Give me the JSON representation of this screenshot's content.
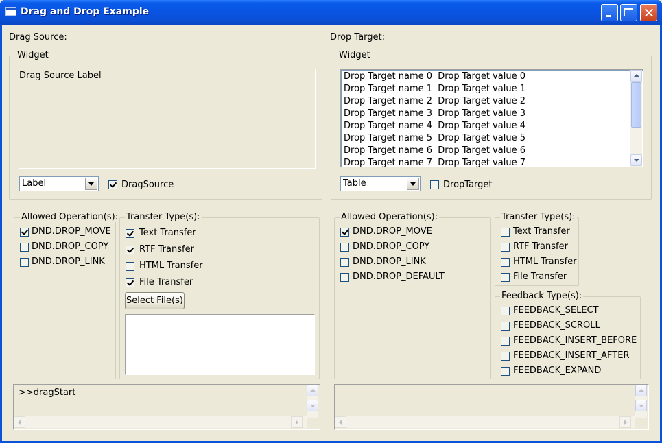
{
  "window": {
    "title": "Drag and Drop Example"
  },
  "source": {
    "heading": "Drag Source:",
    "widget_group": "Widget",
    "widget_label": "Drag Source Label",
    "widget_type": "Label",
    "enable_label": "DragSource",
    "enable_checked": true,
    "ops_title": "Allowed Operation(s):",
    "ops": [
      {
        "label": "DND.DROP_MOVE",
        "checked": true
      },
      {
        "label": "DND.DROP_COPY",
        "checked": false
      },
      {
        "label": "DND.DROP_LINK",
        "checked": false
      }
    ],
    "types_title": "Transfer Type(s):",
    "types": [
      {
        "label": "Text Transfer",
        "checked": true
      },
      {
        "label": "RTF Transfer",
        "checked": true
      },
      {
        "label": "HTML Transfer",
        "checked": false
      },
      {
        "label": "File Transfer",
        "checked": true
      }
    ],
    "select_files_label": "Select File(s)",
    "log_text": ">>dragStart"
  },
  "target": {
    "heading": "Drop Target:",
    "widget_group": "Widget",
    "table_rows": [
      {
        "name": "Drop Target name 0",
        "value": "Drop Target value 0"
      },
      {
        "name": "Drop Target name 1",
        "value": "Drop Target value 1"
      },
      {
        "name": "Drop Target name 2",
        "value": "Drop Target value 2"
      },
      {
        "name": "Drop Target name 3",
        "value": "Drop Target value 3"
      },
      {
        "name": "Drop Target name 4",
        "value": "Drop Target value 4"
      },
      {
        "name": "Drop Target name 5",
        "value": "Drop Target value 5"
      },
      {
        "name": "Drop Target name 6",
        "value": "Drop Target value 6"
      },
      {
        "name": "Drop Target name 7",
        "value": "Drop Target value 7"
      }
    ],
    "widget_type": "Table",
    "enable_label": "DropTarget",
    "enable_checked": false,
    "ops_title": "Allowed Operation(s):",
    "ops": [
      {
        "label": "DND.DROP_MOVE",
        "checked": true
      },
      {
        "label": "DND.DROP_COPY",
        "checked": false
      },
      {
        "label": "DND.DROP_LINK",
        "checked": false
      },
      {
        "label": "DND.DROP_DEFAULT",
        "checked": false
      }
    ],
    "types_title": "Transfer Type(s):",
    "types": [
      {
        "label": "Text Transfer",
        "checked": false
      },
      {
        "label": "RTF Transfer",
        "checked": false
      },
      {
        "label": "HTML Transfer",
        "checked": false
      },
      {
        "label": "File Transfer",
        "checked": false
      }
    ],
    "feedback_title": "Feedback Type(s):",
    "feedback": [
      {
        "label": "FEEDBACK_SELECT",
        "checked": false
      },
      {
        "label": "FEEDBACK_SCROLL",
        "checked": false
      },
      {
        "label": "FEEDBACK_INSERT_BEFORE",
        "checked": false
      },
      {
        "label": "FEEDBACK_INSERT_AFTER",
        "checked": false
      },
      {
        "label": "FEEDBACK_EXPAND",
        "checked": false
      }
    ],
    "log_text": ""
  }
}
